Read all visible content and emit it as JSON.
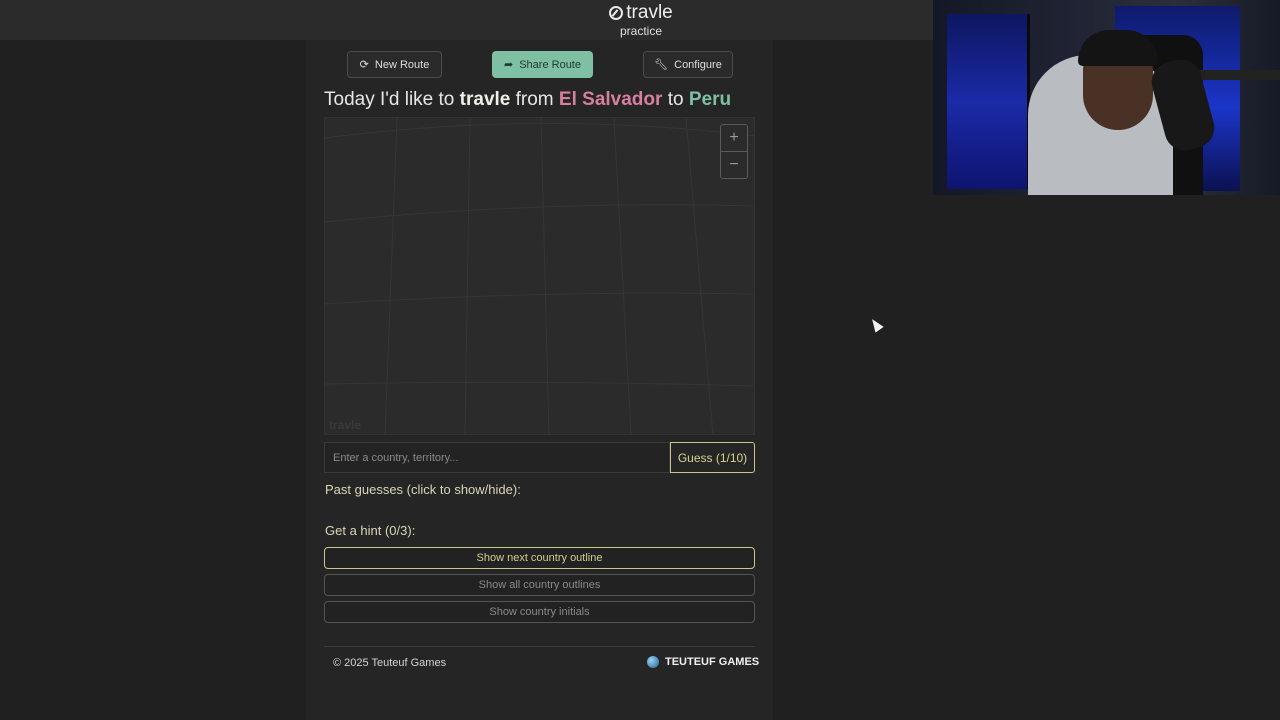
{
  "header": {
    "brand": "travle",
    "subtitle": "practice"
  },
  "toolbar": {
    "new_route": "New Route",
    "share_route": "Share Route",
    "configure": "Configure"
  },
  "headline": {
    "prefix": "Today I'd like to ",
    "game": "travle",
    "from_word": " from ",
    "from_country": "El Salvador",
    "to_word": " to ",
    "to_country": "Peru"
  },
  "map": {
    "watermark": "travle",
    "zoom_in": "+",
    "zoom_out": "−"
  },
  "guess": {
    "placeholder": "Enter a country, territory...",
    "button": "Guess (1/10)"
  },
  "past_guesses": {
    "label": "Past guesses (click to show/hide):"
  },
  "hints": {
    "label": "Get a hint (0/3):",
    "items": [
      "Show next country outline",
      "Show all country outlines",
      "Show country initials"
    ]
  },
  "footer": {
    "copyright": "© 2025 Teuteuf Games",
    "brand": "TEUTEUF GAMES"
  },
  "colors": {
    "accent_green": "#7fbfa3",
    "accent_pink": "#d67fa0",
    "accent_yellow": "#d3cd8e"
  },
  "icons": {
    "brand": "compass-icon",
    "new_route": "refresh-icon",
    "share_route": "share-arrow-icon",
    "configure": "wrench-icon",
    "footer": "globe-icon"
  }
}
